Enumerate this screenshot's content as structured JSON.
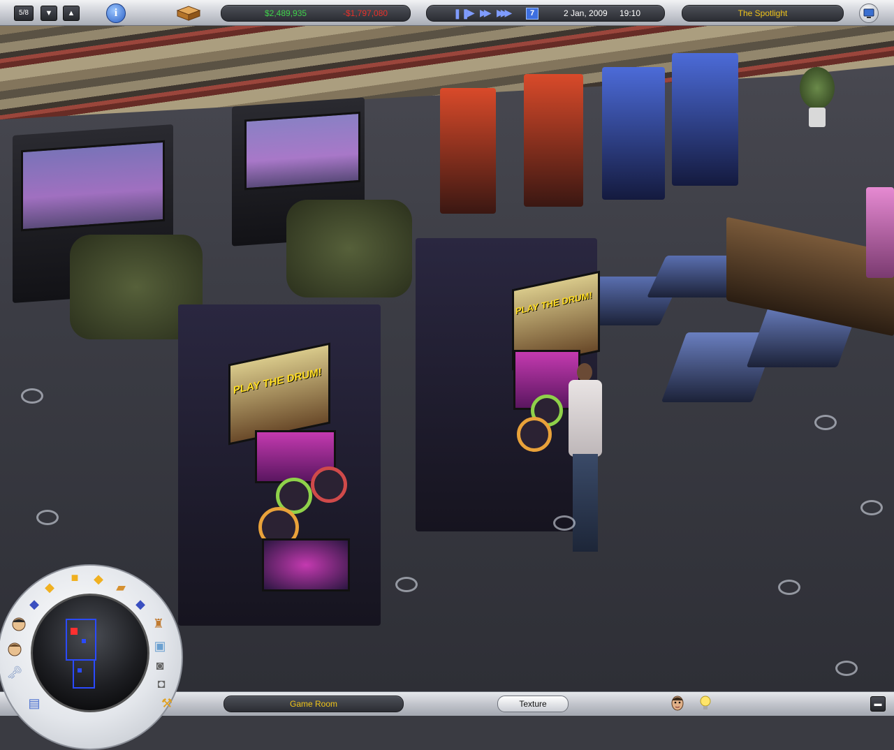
{
  "topbar": {
    "page_counter": "5/8",
    "money": "$2,489,935",
    "expenses": "-$1,797,080",
    "speed_level": "7",
    "date": "2 Jan, 2009",
    "time": "19:10",
    "location_title": "The Spotlight"
  },
  "scene": {
    "drum_marquee_1": "PLAY THE DRUM!",
    "drum_marquee_2": "PLAY THE DRUM!"
  },
  "bottombar": {
    "room_name": "Game Room",
    "mode_button": "Texture"
  },
  "colors": {
    "money": "#3fd24a",
    "expenses": "#e8312a",
    "location_title": "#f0c419",
    "room_name": "#f0c419"
  },
  "icons": {
    "info": "info-icon",
    "build": "crate-icon",
    "pause": "pause-icon",
    "play": "play-icon",
    "fast": "fast-forward-icon",
    "fastest": "fastest-forward-icon",
    "monitor": "monitor-icon"
  }
}
